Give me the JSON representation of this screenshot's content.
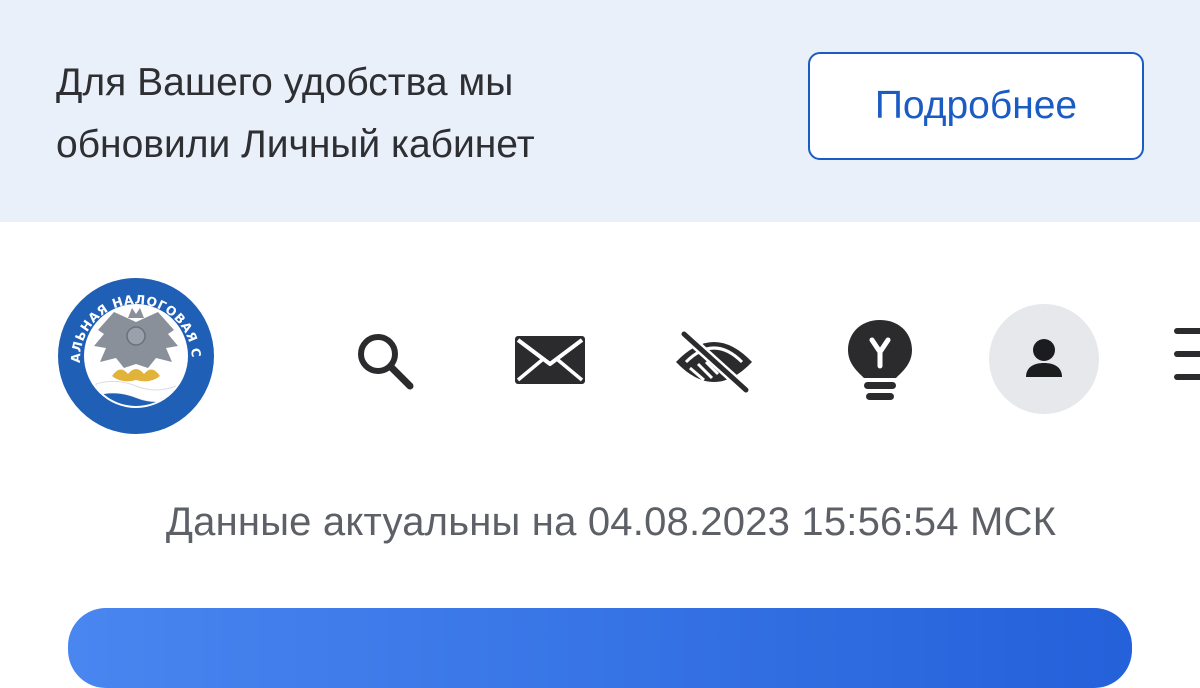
{
  "banner": {
    "line1": "Для Вашего удобства мы",
    "line2": "обновили Личный кабинет",
    "button_label": "Подробнее"
  },
  "header": {
    "logo_text": "ФЕДЕРАЛЬНАЯ НАЛОГОВАЯ СЛУЖБА",
    "icons": [
      "search-icon",
      "mail-icon",
      "eye-off-icon",
      "lightbulb-icon",
      "user-icon",
      "menu-icon"
    ]
  },
  "status": {
    "updated_text": "Данные актуальны на 04.08.2023 15:56:54 МСК"
  },
  "colors": {
    "accent": "#1a5bc4",
    "banner_bg": "#eaf0fa",
    "icon": "#2b2b2e"
  }
}
